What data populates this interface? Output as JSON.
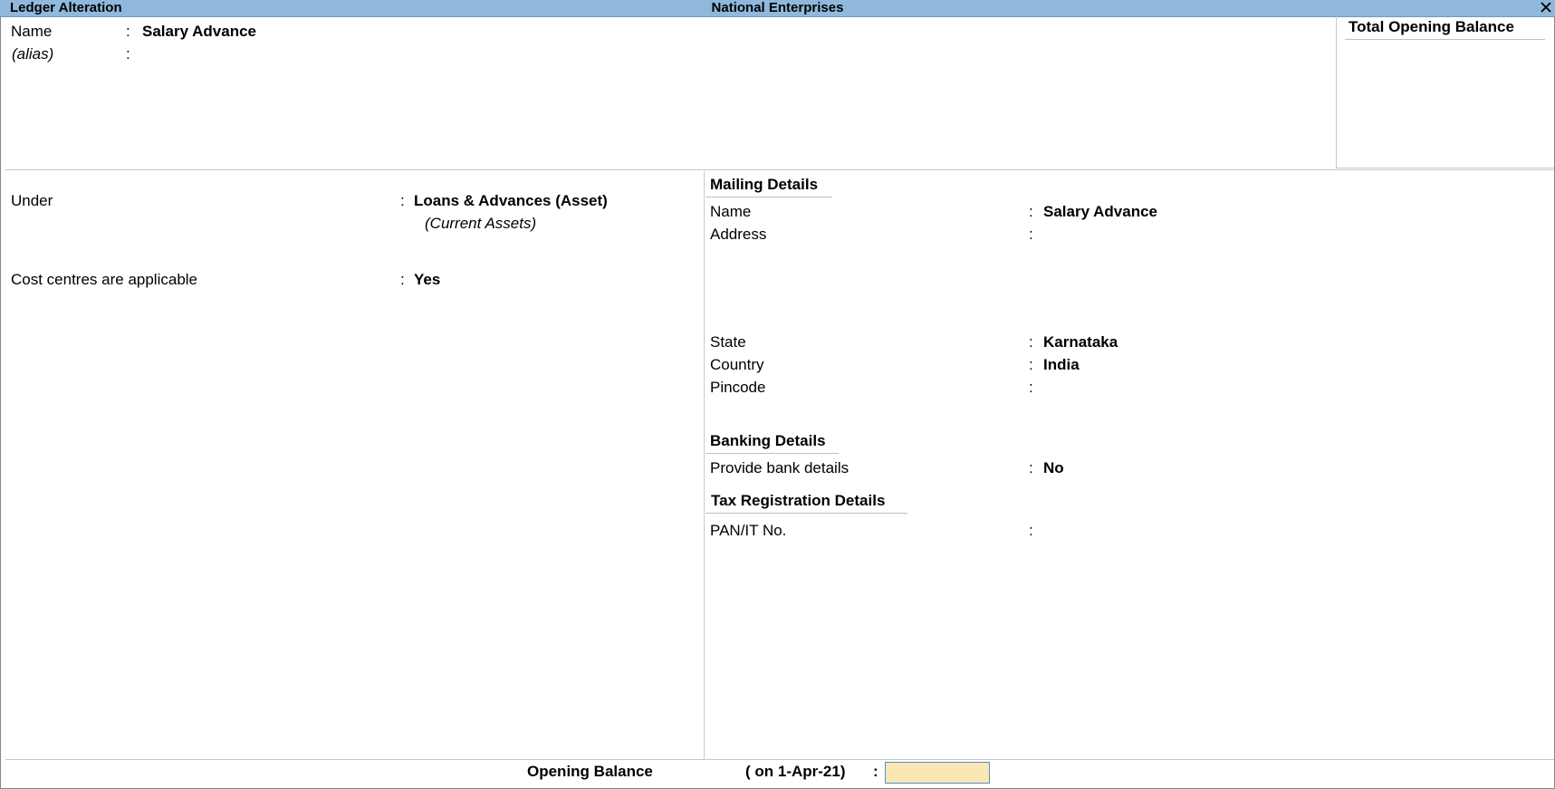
{
  "titlebar": {
    "screen_title": "Ledger Alteration",
    "company": "National Enterprises",
    "close_icon": "close-icon"
  },
  "top": {
    "name_label": "Name",
    "name_value": "Salary Advance",
    "alias_label": "(alias)",
    "colon": ":"
  },
  "total_opening_balance": {
    "label": "Total Opening Balance"
  },
  "left": {
    "under_label": "Under",
    "under_value": "Loans & Advances (Asset)",
    "under_parent": "(Current Assets)",
    "cost_centres_label": "Cost centres are applicable",
    "cost_centres_value": "Yes"
  },
  "mailing": {
    "heading": "Mailing Details",
    "name_label": "Name",
    "name_value": "Salary Advance",
    "address_label": "Address",
    "state_label": "State",
    "state_value": "Karnataka",
    "country_label": "Country",
    "country_value": "India",
    "pincode_label": "Pincode"
  },
  "banking": {
    "heading": "Banking Details",
    "provide_label": "Provide bank details",
    "provide_value": "No"
  },
  "tax": {
    "heading": "Tax Registration Details",
    "pan_label": "PAN/IT No."
  },
  "footer": {
    "opening_balance_label": "Opening Balance",
    "date_label": "( on 1-Apr-21)",
    "colon": ":",
    "opening_balance_value": ""
  },
  "colors": {
    "titlebar": "#8fb8dc",
    "input_bg": "#fbe7b4"
  }
}
